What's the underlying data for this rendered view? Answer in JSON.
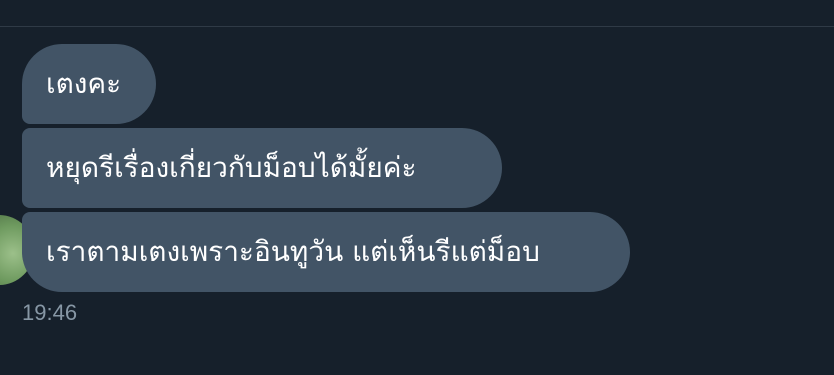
{
  "conversation": {
    "messages": [
      {
        "text": "เตงคะ"
      },
      {
        "text": "หยุดรีเรื่องเกี่ยวกับม็อบได้มั้ยค่ะ"
      },
      {
        "text": "เราตามเตงเพราะอินทูวัน แต่เห็นรีแต่ม็อบ"
      }
    ],
    "timestamp": "19:46"
  },
  "colors": {
    "background": "#16202b",
    "bubble": "#425466",
    "timestamp_text": "#8797a5"
  }
}
